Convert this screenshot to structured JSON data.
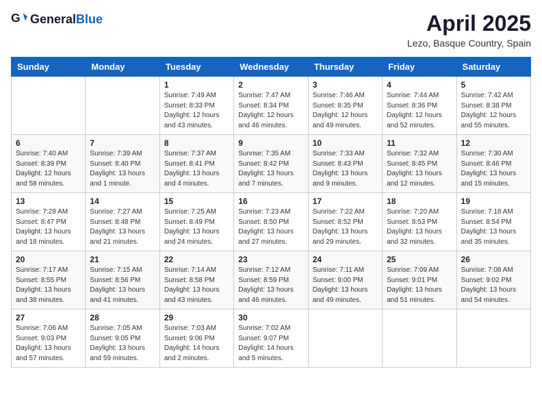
{
  "header": {
    "logo_general": "General",
    "logo_blue": "Blue",
    "month_year": "April 2025",
    "location": "Lezo, Basque Country, Spain"
  },
  "weekdays": [
    "Sunday",
    "Monday",
    "Tuesday",
    "Wednesday",
    "Thursday",
    "Friday",
    "Saturday"
  ],
  "weeks": [
    [
      {
        "day": "",
        "info": ""
      },
      {
        "day": "",
        "info": ""
      },
      {
        "day": "1",
        "info": "Sunrise: 7:49 AM\nSunset: 8:33 PM\nDaylight: 12 hours and 43 minutes."
      },
      {
        "day": "2",
        "info": "Sunrise: 7:47 AM\nSunset: 8:34 PM\nDaylight: 12 hours and 46 minutes."
      },
      {
        "day": "3",
        "info": "Sunrise: 7:46 AM\nSunset: 8:35 PM\nDaylight: 12 hours and 49 minutes."
      },
      {
        "day": "4",
        "info": "Sunrise: 7:44 AM\nSunset: 8:36 PM\nDaylight: 12 hours and 52 minutes."
      },
      {
        "day": "5",
        "info": "Sunrise: 7:42 AM\nSunset: 8:38 PM\nDaylight: 12 hours and 55 minutes."
      }
    ],
    [
      {
        "day": "6",
        "info": "Sunrise: 7:40 AM\nSunset: 8:39 PM\nDaylight: 12 hours and 58 minutes."
      },
      {
        "day": "7",
        "info": "Sunrise: 7:39 AM\nSunset: 8:40 PM\nDaylight: 13 hours and 1 minute."
      },
      {
        "day": "8",
        "info": "Sunrise: 7:37 AM\nSunset: 8:41 PM\nDaylight: 13 hours and 4 minutes."
      },
      {
        "day": "9",
        "info": "Sunrise: 7:35 AM\nSunset: 8:42 PM\nDaylight: 13 hours and 7 minutes."
      },
      {
        "day": "10",
        "info": "Sunrise: 7:33 AM\nSunset: 8:43 PM\nDaylight: 13 hours and 9 minutes."
      },
      {
        "day": "11",
        "info": "Sunrise: 7:32 AM\nSunset: 8:45 PM\nDaylight: 13 hours and 12 minutes."
      },
      {
        "day": "12",
        "info": "Sunrise: 7:30 AM\nSunset: 8:46 PM\nDaylight: 13 hours and 15 minutes."
      }
    ],
    [
      {
        "day": "13",
        "info": "Sunrise: 7:28 AM\nSunset: 8:47 PM\nDaylight: 13 hours and 18 minutes."
      },
      {
        "day": "14",
        "info": "Sunrise: 7:27 AM\nSunset: 8:48 PM\nDaylight: 13 hours and 21 minutes."
      },
      {
        "day": "15",
        "info": "Sunrise: 7:25 AM\nSunset: 8:49 PM\nDaylight: 13 hours and 24 minutes."
      },
      {
        "day": "16",
        "info": "Sunrise: 7:23 AM\nSunset: 8:50 PM\nDaylight: 13 hours and 27 minutes."
      },
      {
        "day": "17",
        "info": "Sunrise: 7:22 AM\nSunset: 8:52 PM\nDaylight: 13 hours and 29 minutes."
      },
      {
        "day": "18",
        "info": "Sunrise: 7:20 AM\nSunset: 8:53 PM\nDaylight: 13 hours and 32 minutes."
      },
      {
        "day": "19",
        "info": "Sunrise: 7:18 AM\nSunset: 8:54 PM\nDaylight: 13 hours and 35 minutes."
      }
    ],
    [
      {
        "day": "20",
        "info": "Sunrise: 7:17 AM\nSunset: 8:55 PM\nDaylight: 13 hours and 38 minutes."
      },
      {
        "day": "21",
        "info": "Sunrise: 7:15 AM\nSunset: 8:56 PM\nDaylight: 13 hours and 41 minutes."
      },
      {
        "day": "22",
        "info": "Sunrise: 7:14 AM\nSunset: 8:58 PM\nDaylight: 13 hours and 43 minutes."
      },
      {
        "day": "23",
        "info": "Sunrise: 7:12 AM\nSunset: 8:59 PM\nDaylight: 13 hours and 46 minutes."
      },
      {
        "day": "24",
        "info": "Sunrise: 7:11 AM\nSunset: 9:00 PM\nDaylight: 13 hours and 49 minutes."
      },
      {
        "day": "25",
        "info": "Sunrise: 7:09 AM\nSunset: 9:01 PM\nDaylight: 13 hours and 51 minutes."
      },
      {
        "day": "26",
        "info": "Sunrise: 7:08 AM\nSunset: 9:02 PM\nDaylight: 13 hours and 54 minutes."
      }
    ],
    [
      {
        "day": "27",
        "info": "Sunrise: 7:06 AM\nSunset: 9:03 PM\nDaylight: 13 hours and 57 minutes."
      },
      {
        "day": "28",
        "info": "Sunrise: 7:05 AM\nSunset: 9:05 PM\nDaylight: 13 hours and 59 minutes."
      },
      {
        "day": "29",
        "info": "Sunrise: 7:03 AM\nSunset: 9:06 PM\nDaylight: 14 hours and 2 minutes."
      },
      {
        "day": "30",
        "info": "Sunrise: 7:02 AM\nSunset: 9:07 PM\nDaylight: 14 hours and 5 minutes."
      },
      {
        "day": "",
        "info": ""
      },
      {
        "day": "",
        "info": ""
      },
      {
        "day": "",
        "info": ""
      }
    ]
  ]
}
